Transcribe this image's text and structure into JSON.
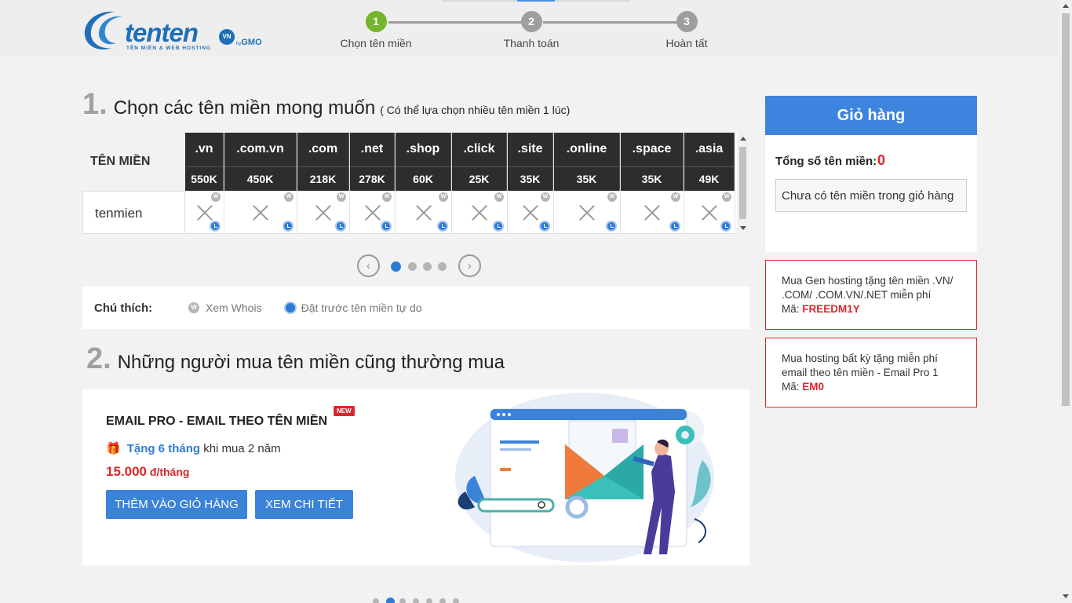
{
  "header": {
    "logo": {
      "brand": "tenten",
      "badge": "VN",
      "by": "by",
      "gmo": "GMO",
      "tagline": "TÊN MIỀN & WEB HOSTING"
    },
    "steps": [
      {
        "num": "1",
        "label": "Chọn tên miền",
        "active": true
      },
      {
        "num": "2",
        "label": "Thanh toán",
        "active": false
      },
      {
        "num": "3",
        "label": "Hoàn tất",
        "active": false
      }
    ]
  },
  "section1": {
    "num": "1.",
    "title": "Chọn các tên miền mong muốn",
    "note": "( Có thể lựa chọn nhiều tên miền 1 lúc)",
    "table_label": "TÊN MIỀN",
    "domain_name": "tenmien",
    "extensions": [
      {
        "ext": ".vn",
        "price": "550K"
      },
      {
        "ext": ".com.vn",
        "price": "450K"
      },
      {
        "ext": ".com",
        "price": "218K"
      },
      {
        "ext": ".net",
        "price": "278K"
      },
      {
        "ext": ".shop",
        "price": "60K"
      },
      {
        "ext": ".click",
        "price": "25K"
      },
      {
        "ext": ".site",
        "price": "35K"
      },
      {
        "ext": ".online",
        "price": "35K"
      },
      {
        "ext": ".space",
        "price": "35K"
      },
      {
        "ext": ".asia",
        "price": "49K"
      }
    ],
    "pager": {
      "prev": "‹",
      "next": "›",
      "pages": 4,
      "active": 1
    }
  },
  "legend": {
    "title": "Chú thích:",
    "whois_badge": "W",
    "whois": "Xem Whois",
    "reserve": "Đặt trước tên miền tự do"
  },
  "section2": {
    "num": "2.",
    "title": "Những người mua tên miền cũng thường mua",
    "card": {
      "title": "EMAIL PRO - EMAIL THEO TÊN MIỀN",
      "badge": "NEW",
      "gift_highlight": "Tặng 6 tháng",
      "gift_rest": " khi mua 2 năm",
      "price": "15.000",
      "price_unit": " đ/tháng",
      "add_button": "THÊM VÀO GIỎ HÀNG",
      "detail_button": "XEM CHI TIẾT"
    },
    "carousel": {
      "count": 7,
      "active": 2
    }
  },
  "cart": {
    "title": "Giỏ hàng",
    "count_label": "Tổng số tên miền:",
    "count_value": "0",
    "empty_text": "Chưa có tên miền trong giỏ hàng"
  },
  "coupons": [
    {
      "line1": "Mua Gen hosting tặng tên miền .VN/",
      "line2": ".COM/ .COM.VN/.NET miễn phí",
      "code_label": "Mã: ",
      "code": "FREEDM1Y"
    },
    {
      "line1": "Mua hosting bất kỳ tặng miễn phí",
      "line2": "email theo tên miền - Email Pro 1",
      "code_label": "Mã: ",
      "code": "EM0"
    }
  ],
  "colors": {
    "accent": "#3d84df",
    "step_active": "#73b52b",
    "danger": "#d9262c",
    "table_head": "#2d2d2d"
  }
}
